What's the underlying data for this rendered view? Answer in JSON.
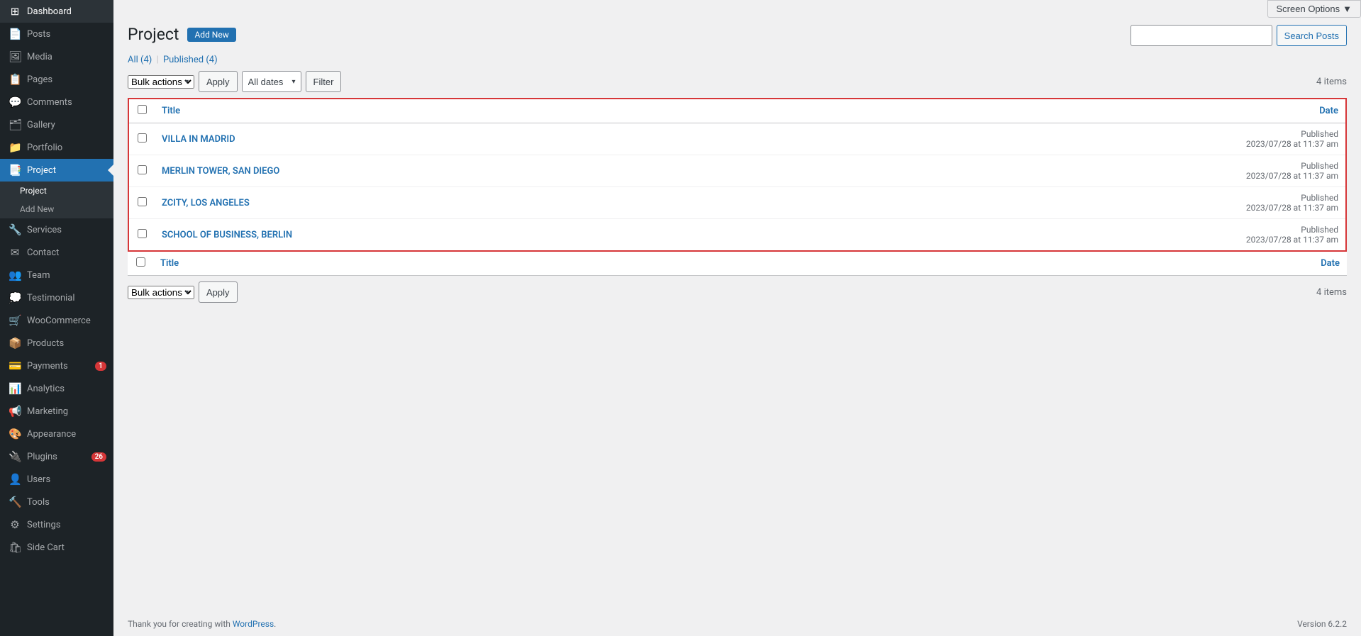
{
  "sidebar": {
    "items": [
      {
        "id": "dashboard",
        "label": "Dashboard",
        "icon": "⊞",
        "active": false
      },
      {
        "id": "posts",
        "label": "Posts",
        "icon": "📄",
        "active": false
      },
      {
        "id": "media",
        "label": "Media",
        "icon": "🖼",
        "active": false
      },
      {
        "id": "pages",
        "label": "Pages",
        "icon": "📋",
        "active": false
      },
      {
        "id": "comments",
        "label": "Comments",
        "icon": "💬",
        "active": false
      },
      {
        "id": "gallery",
        "label": "Gallery",
        "icon": "🗂",
        "active": false
      },
      {
        "id": "portfolio",
        "label": "Portfolio",
        "icon": "📁",
        "active": false
      },
      {
        "id": "project",
        "label": "Project",
        "icon": "📑",
        "active": true
      },
      {
        "id": "services",
        "label": "Services",
        "icon": "🔧",
        "active": false
      },
      {
        "id": "contact",
        "label": "Contact",
        "icon": "✉",
        "active": false
      },
      {
        "id": "team",
        "label": "Team",
        "icon": "👥",
        "active": false
      },
      {
        "id": "testimonial",
        "label": "Testimonial",
        "icon": "💭",
        "active": false
      },
      {
        "id": "woocommerce",
        "label": "WooCommerce",
        "icon": "🛒",
        "active": false
      },
      {
        "id": "products",
        "label": "Products",
        "icon": "📦",
        "active": false
      },
      {
        "id": "payments",
        "label": "Payments",
        "icon": "💳",
        "active": false,
        "badge": "1"
      },
      {
        "id": "analytics",
        "label": "Analytics",
        "icon": "📊",
        "active": false
      },
      {
        "id": "marketing",
        "label": "Marketing",
        "icon": "📢",
        "active": false
      },
      {
        "id": "appearance",
        "label": "Appearance",
        "icon": "🎨",
        "active": false
      },
      {
        "id": "plugins",
        "label": "Plugins",
        "icon": "🔌",
        "active": false,
        "badge": "26"
      },
      {
        "id": "users",
        "label": "Users",
        "icon": "👤",
        "active": false
      },
      {
        "id": "tools",
        "label": "Tools",
        "icon": "🔨",
        "active": false
      },
      {
        "id": "settings",
        "label": "Settings",
        "icon": "⚙",
        "active": false
      },
      {
        "id": "side-cart",
        "label": "Side Cart",
        "icon": "🛍",
        "active": false
      }
    ],
    "sub_menu": {
      "parent": "project",
      "items": [
        {
          "id": "project-list",
          "label": "Project",
          "active": true
        },
        {
          "id": "project-add",
          "label": "Add New",
          "active": false
        }
      ]
    }
  },
  "screen_options": {
    "label": "Screen Options",
    "arrow": "▼"
  },
  "header": {
    "title": "Project",
    "add_new_label": "Add New"
  },
  "filter_links": {
    "all_label": "All",
    "all_count": "(4)",
    "separator": "|",
    "published_label": "Published",
    "published_count": "(4)"
  },
  "top_action_bar": {
    "bulk_actions_label": "Bulk actions",
    "apply_label": "Apply",
    "all_dates_label": "All dates",
    "filter_label": "Filter",
    "items_count": "4 items"
  },
  "bottom_action_bar": {
    "bulk_actions_label": "Bulk actions",
    "apply_label": "Apply",
    "items_count": "4 items"
  },
  "search": {
    "placeholder": "",
    "button_label": "Search Posts"
  },
  "table": {
    "columns": [
      {
        "id": "title",
        "label": "Title"
      },
      {
        "id": "date",
        "label": "Date"
      }
    ],
    "rows": [
      {
        "id": 1,
        "title": "VILLA IN MADRID",
        "status": "Published",
        "date": "2023/07/28 at 11:37 am"
      },
      {
        "id": 2,
        "title": "MERLIN TOWER, SAN DIEGO",
        "status": "Published",
        "date": "2023/07/28 at 11:37 am"
      },
      {
        "id": 3,
        "title": "ZCITY, LOS ANGELES",
        "status": "Published",
        "date": "2023/07/28 at 11:37 am"
      },
      {
        "id": 4,
        "title": "SCHOOL OF BUSINESS, BERLIN",
        "status": "Published",
        "date": "2023/07/28 at 11:37 am"
      }
    ]
  },
  "footer": {
    "thank_you_text": "Thank you for creating with",
    "wordpress_link": "WordPress",
    "version_label": "Version 6.2.2"
  }
}
